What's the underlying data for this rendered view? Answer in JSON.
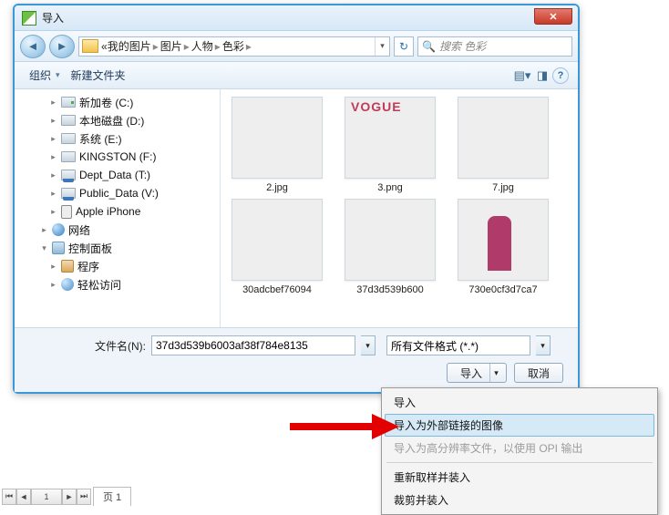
{
  "window": {
    "title": "导入"
  },
  "nav": {
    "crumbs": [
      "我的图片",
      "图片",
      "人物",
      "色彩"
    ],
    "search_placeholder": "搜索 色彩"
  },
  "toolbar": {
    "organize": "组织",
    "newfolder": "新建文件夹"
  },
  "tree": {
    "items": [
      {
        "label": "新加卷 (C:)",
        "icon": "drive-g",
        "exp": "▸"
      },
      {
        "label": "本地磁盘 (D:)",
        "icon": "drive",
        "exp": "▸"
      },
      {
        "label": "系统 (E:)",
        "icon": "drive",
        "exp": "▸"
      },
      {
        "label": "KINGSTON (F:)",
        "icon": "drive",
        "exp": "▸"
      },
      {
        "label": "Dept_Data (T:)",
        "icon": "netdrv",
        "exp": "▸"
      },
      {
        "label": "Public_Data (V:)",
        "icon": "netdrv",
        "exp": "▸"
      },
      {
        "label": "Apple iPhone",
        "icon": "phone",
        "exp": "▸"
      },
      {
        "label": "网络",
        "icon": "net",
        "exp": "▸",
        "l": 2
      },
      {
        "label": "控制面板",
        "icon": "cp",
        "exp": "▾",
        "l": 2
      },
      {
        "label": "程序",
        "icon": "prog",
        "exp": "▸"
      },
      {
        "label": "轻松访问",
        "icon": "ease",
        "exp": "▸"
      }
    ]
  },
  "gallery": [
    {
      "name": "2.jpg",
      "cls": "p0"
    },
    {
      "name": "3.png",
      "cls": "p1"
    },
    {
      "name": "7.jpg",
      "cls": "p2"
    },
    {
      "name": "30adcbef76094",
      "cls": "p3"
    },
    {
      "name": "37d3d539b600",
      "cls": "p4"
    },
    {
      "name": "730e0cf3d7ca7",
      "cls": "p5"
    }
  ],
  "bottom": {
    "filename_label": "文件名(N):",
    "filename_value": "37d3d539b6003af38f784e8135",
    "filter": "所有文件格式 (*.*)",
    "import": "导入",
    "cancel": "取消"
  },
  "menu": {
    "items": [
      {
        "label": "导入",
        "state": ""
      },
      {
        "label": "导入为外部链接的图像",
        "state": "hover"
      },
      {
        "label": "导入为高分辨率文件，以使用 OPI 输出",
        "state": "disabled"
      },
      {
        "label": "重新取样并装入",
        "state": ""
      },
      {
        "label": "裁剪并装入",
        "state": ""
      }
    ]
  },
  "pagetab": {
    "label": "页 1"
  }
}
